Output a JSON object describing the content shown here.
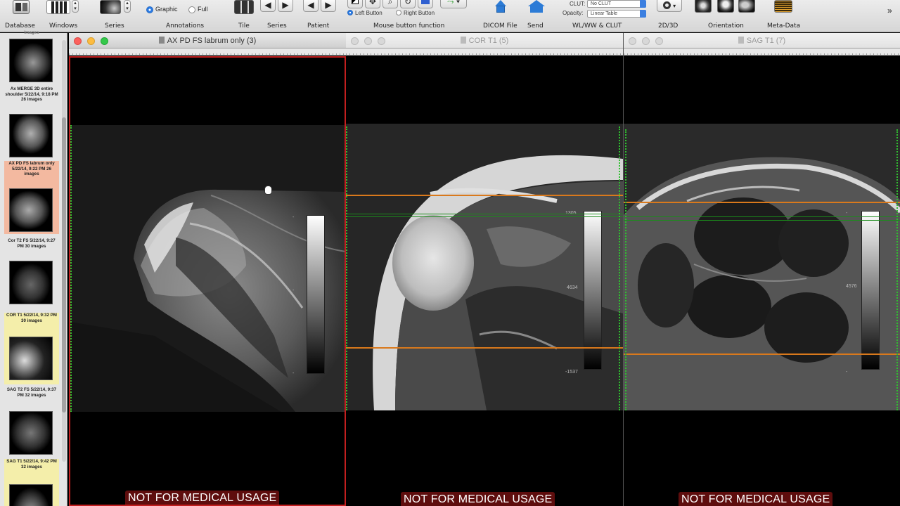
{
  "toolbar": {
    "items": [
      {
        "label": "Database",
        "icon": "database-icon"
      },
      {
        "label": "Windows",
        "icon": "windows-icon"
      },
      {
        "label": "Series",
        "icon": "series-thumbnail-icon"
      },
      {
        "label": "Annotations",
        "icon": "annotations-icon"
      },
      {
        "label": "Tile",
        "icon": "tile-icon"
      },
      {
        "label": "Series",
        "icon": "series-arrows-icon"
      },
      {
        "label": "Patient",
        "icon": "patient-arrows-icon"
      },
      {
        "label": "Mouse button function",
        "icon": "mouse-tools-icon"
      },
      {
        "label": "DICOM File",
        "icon": "dicom-file-icon"
      },
      {
        "label": "Send",
        "icon": "send-icon"
      },
      {
        "label": "WL/WW & CLUT",
        "icon": "wlww-icon"
      },
      {
        "label": "2D/3D",
        "icon": "gear-icon"
      },
      {
        "label": "Orientation",
        "icon": "orientation-icon"
      },
      {
        "label": "Meta-Data",
        "icon": "metadata-icon"
      }
    ],
    "annotations": {
      "graphic": "Graphic",
      "full": "Full",
      "selected": "Graphic"
    },
    "mouse": {
      "left": "Left Button",
      "right": "Right Button",
      "selected": "Left Button"
    },
    "clut": {
      "clut_label": "CLUT:",
      "clut_value": "No CLUT",
      "opacity_label": "Opacity:",
      "opacity_value": "Linear Table"
    },
    "overflow": "»"
  },
  "sidebar": {
    "top_caption": "Images",
    "series": [
      {
        "title": "Ax MERGE 3D entire shoulder 5/22/14, 9:18 PM 26 images",
        "highlight": "none"
      },
      {
        "title": "AX PD FS labrum only 5/22/14, 9:22 PM 26 images",
        "highlight": "orange"
      },
      {
        "title": "Cor T2 FS 5/22/14, 9:27 PM 30 images",
        "highlight": "none"
      },
      {
        "title": "COR T1 5/22/14, 9:32 PM 30 images",
        "highlight": "yellow"
      },
      {
        "title": "SAG T2 FS 5/22/14, 9:37 PM 32 images",
        "highlight": "none"
      },
      {
        "title": "SAG T1 5/22/14, 9:42 PM 32 images",
        "highlight": "yellow"
      }
    ]
  },
  "viewers": [
    {
      "title": "AX PD FS labrum only (3)",
      "active": true,
      "wl_top": "-",
      "wl_mid": "-",
      "wl_bottom": "-",
      "warning": "NOT FOR MEDICAL USAGE"
    },
    {
      "title": "COR T1 (5)",
      "active": false,
      "wl_top": "1305",
      "wl_mid": "4634",
      "wl_bottom": "-1537",
      "warning": "NOT FOR MEDICAL USAGE"
    },
    {
      "title": "SAG T1 (7)",
      "active": false,
      "wl_top": "-",
      "wl_mid": "4576",
      "wl_bottom": "-",
      "warning": "NOT FOR MEDICAL USAGE"
    }
  ],
  "colors": {
    "active_border": "#c21f1f",
    "reference_line": "#d9791c",
    "position_line": "#1b8c1b",
    "warning_bg": "#5e0d0d",
    "highlight_orange": "#f3b9a0",
    "highlight_yellow": "#f4eeaa"
  }
}
